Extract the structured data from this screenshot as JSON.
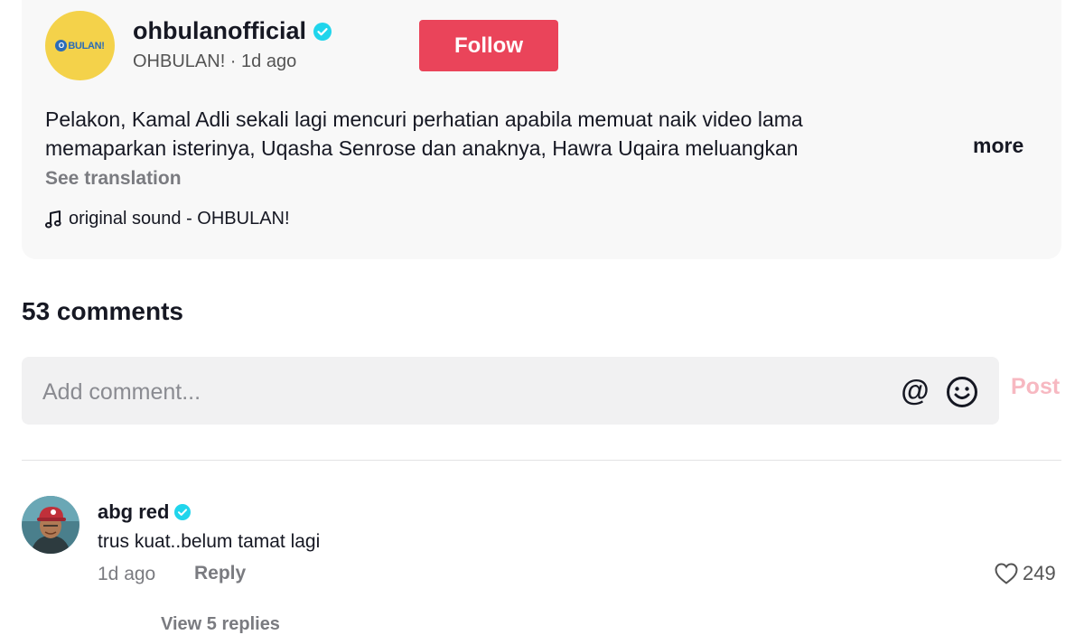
{
  "post": {
    "username": "ohbulanofficial",
    "display_name": "OHBULAN!",
    "time_ago": "1d ago",
    "separator": " · ",
    "brand_logo_text": "BULAN!",
    "follow_label": "Follow",
    "description_lines": [
      "Pelakon, Kamal Adli sekali lagi mencuri perhatian apabila memuat naik video lama",
      "memaparkan isterinya, Uqasha Senrose dan anaknya, Hawra Uqaira meluangkan"
    ],
    "more_label": "more",
    "see_translation": "See translation",
    "sound": "original sound - OHBULAN!"
  },
  "comments_section": {
    "count_label": "53 comments",
    "input_placeholder": "Add comment...",
    "post_label": "Post"
  },
  "comments": [
    {
      "username": "abg red",
      "text": "trus kuat..belum tamat lagi",
      "time_ago": "1d ago",
      "reply_label": "Reply",
      "likes": "249",
      "view_replies": "View 5 replies"
    }
  ],
  "colors": {
    "accent": "#ea445a",
    "verified": "#20d5ec",
    "post_disabled": "#f7b8c1"
  },
  "icons": [
    "verified-badge-icon",
    "music-note-icon",
    "at-mention-icon",
    "emoji-icon",
    "heart-icon"
  ]
}
